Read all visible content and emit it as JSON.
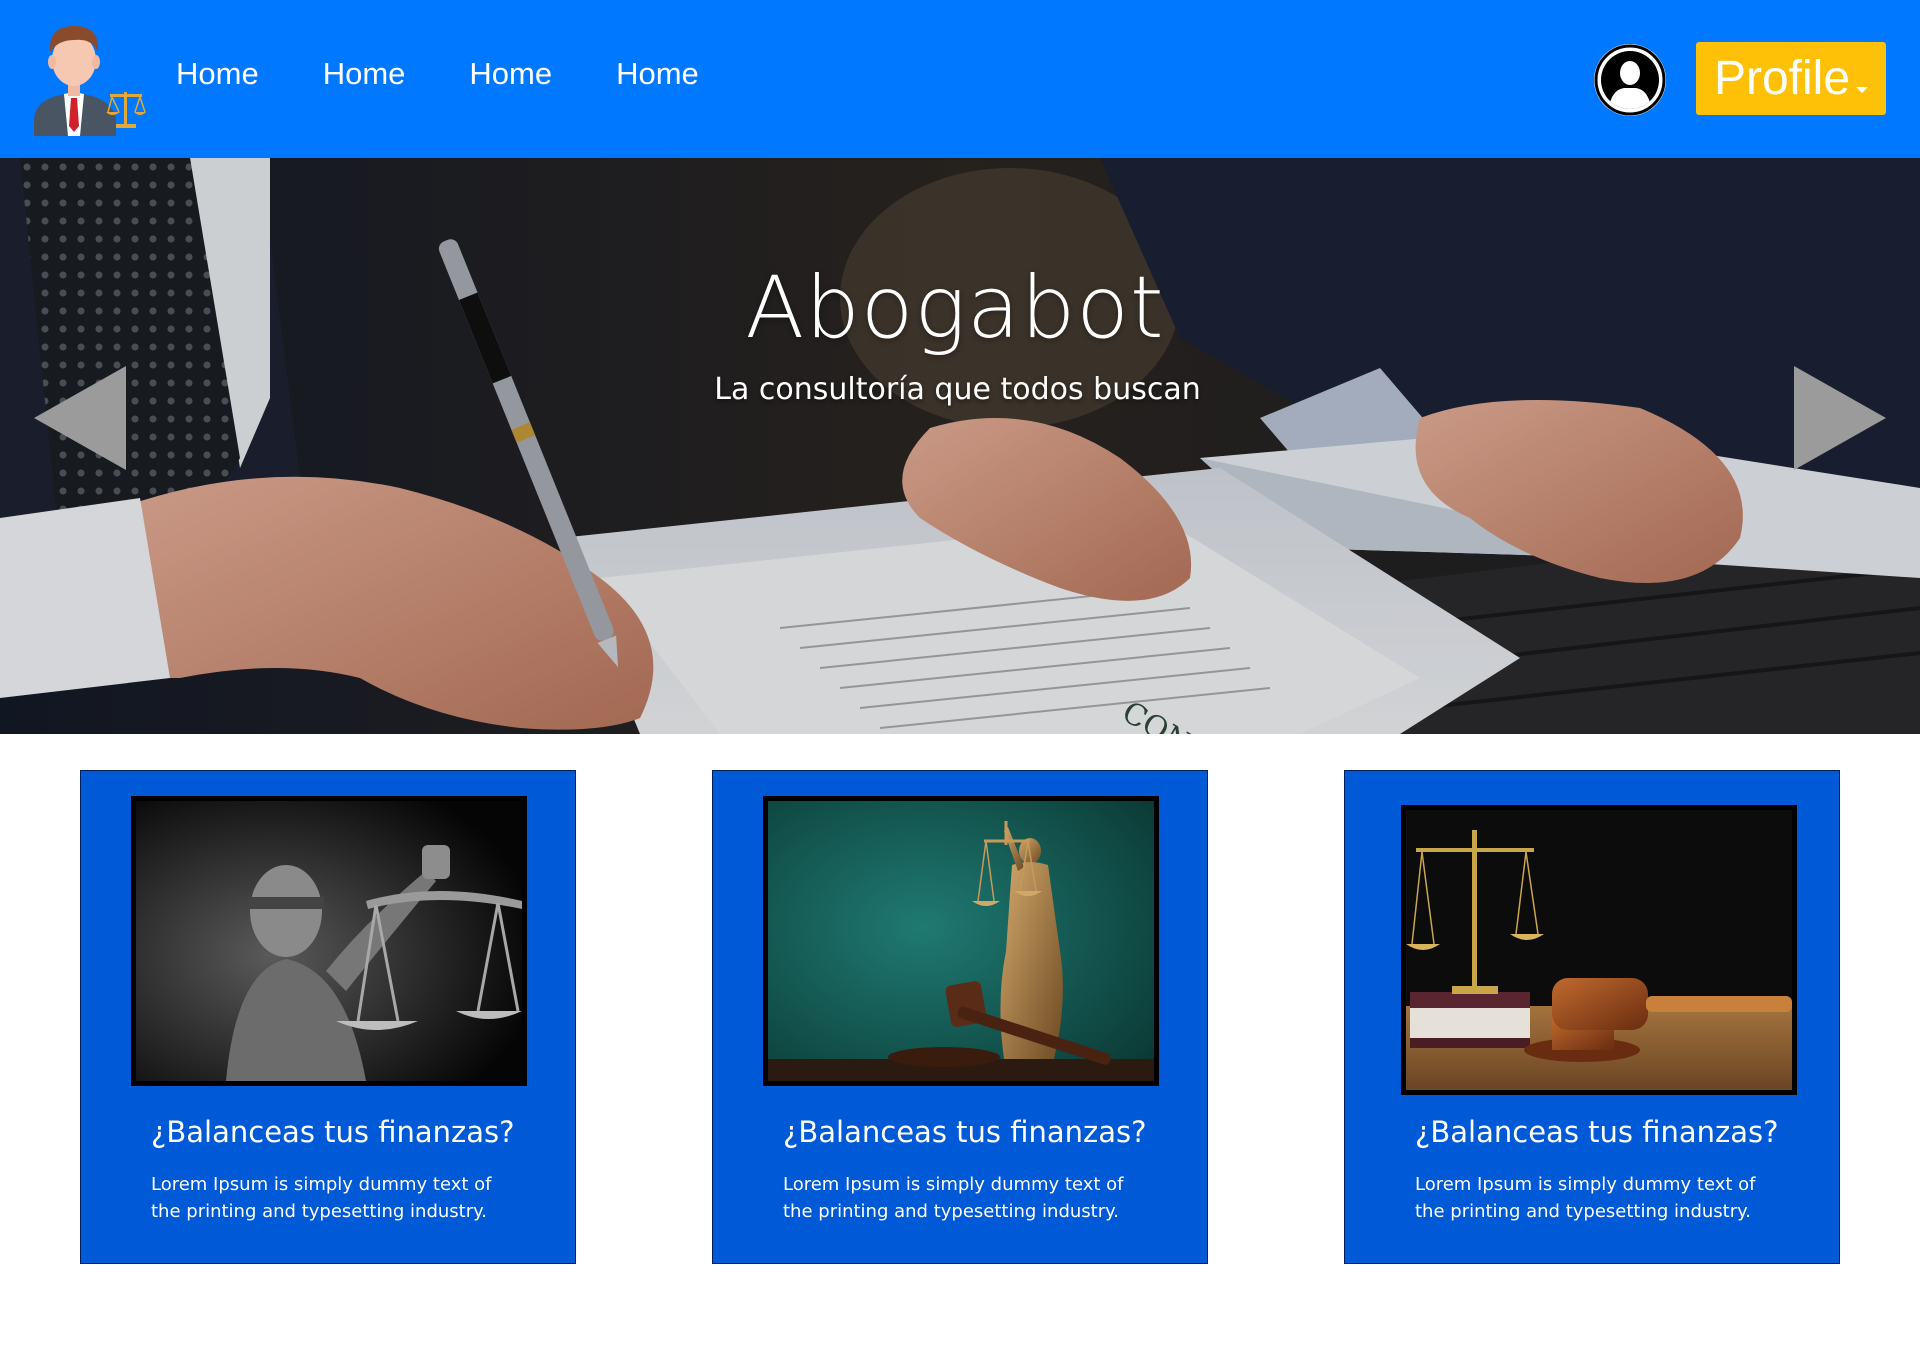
{
  "navbar": {
    "background": "#0078ff",
    "logo_icon": "lawyer-with-scales-icon",
    "links": [
      {
        "label": "Home"
      },
      {
        "label": "Home"
      },
      {
        "label": "Home"
      },
      {
        "label": "Home"
      }
    ],
    "avatar_icon": "user-silhouette-icon",
    "profile_button": {
      "label": "Profile",
      "color": "#ffc107",
      "icon": "caret-down-icon"
    }
  },
  "hero": {
    "title": "Abogabot",
    "subtitle": "La consultoría que todos buscan",
    "prev_icon": "triangle-left-icon",
    "next_icon": "triangle-right-icon"
  },
  "cards": [
    {
      "image_icon": "lady-justice-scales-bw-photo",
      "title": "¿Balanceas tus finanzas?",
      "text": "Lorem Ipsum is simply dummy text of the printing and typesetting industry."
    },
    {
      "image_icon": "justice-statue-gavel-photo",
      "title": "¿Balanceas tus finanzas?",
      "text": "Lorem Ipsum is simply dummy text of the printing and typesetting industry."
    },
    {
      "image_icon": "scales-gavel-books-photo",
      "title": "¿Balanceas tus finanzas?",
      "text": "Lorem Ipsum is simply dummy text of the printing and typesetting industry."
    }
  ],
  "colors": {
    "card_background": "#0059d6",
    "accent_yellow": "#ffc107"
  }
}
